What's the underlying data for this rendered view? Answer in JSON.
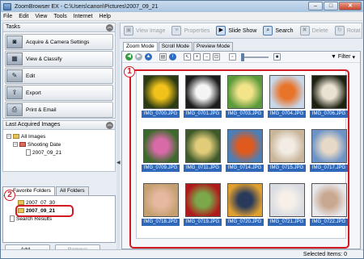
{
  "window": {
    "title": "ZoomBrowser EX - C:\\Users\\canon\\Pictures\\2007_09_21"
  },
  "menu": [
    "File",
    "Edit",
    "View",
    "Tools",
    "Internet",
    "Help"
  ],
  "tasks": {
    "header": "Tasks",
    "items": [
      {
        "label": "Acquire & Camera Settings",
        "icon": "camera-icon"
      },
      {
        "label": "View & Classify",
        "icon": "view-icon"
      },
      {
        "label": "Edit",
        "icon": "edit-icon"
      },
      {
        "label": "Export",
        "icon": "export-icon"
      },
      {
        "label": "Print & Email",
        "icon": "print-icon"
      }
    ]
  },
  "last_acquired": {
    "header": "Last Acquired Images",
    "all_images": "All Images",
    "shooting_date": "Shooting Date",
    "date": "2007_09_21"
  },
  "folders": {
    "tab_favorite": "Favorite Folders",
    "tab_all": "All Folders",
    "items": [
      "2007_07_30",
      "2007_09_21"
    ],
    "search": "Search Results",
    "add_label": "Add...",
    "remove_label": "Remove"
  },
  "toolbar": {
    "view_image": "View Image",
    "properties": "Properties",
    "slide_show": "Slide Show",
    "search": "Search",
    "delete": "Delete",
    "rotate": "Rotat"
  },
  "view_tabs": [
    "Zoom Mode",
    "Scroll Mode",
    "Preview Mode"
  ],
  "filter_label": "Filter",
  "callouts": [
    "1",
    "2"
  ],
  "thumbnails": [
    {
      "caption": "IMG_0700.JPG",
      "colors": [
        "#2b3a12",
        "#f0c21a"
      ]
    },
    {
      "caption": "IMG_0701.JPG",
      "colors": [
        "#1c1c1c",
        "#f4f4f4"
      ]
    },
    {
      "caption": "IMG_0703.JPG",
      "colors": [
        "#5a9a3a",
        "#f3e48a"
      ]
    },
    {
      "caption": "IMG_0704.JPG",
      "colors": [
        "#c8d7ea",
        "#e8742a"
      ]
    },
    {
      "caption": "IMG_0706.JPG",
      "colors": [
        "#1d2110",
        "#e9e1d2"
      ]
    },
    {
      "caption": "IMG_0709.JPG",
      "colors": [
        "#3b6a2a",
        "#d86aa8"
      ]
    },
    {
      "caption": "IMG_0711.JPG",
      "colors": [
        "#3f5a2a",
        "#e1cc7a"
      ]
    },
    {
      "caption": "IMG_0714.JPG",
      "colors": [
        "#4a7fb8",
        "#e05a1e"
      ]
    },
    {
      "caption": "IMG_0715.JPG",
      "colors": [
        "#c9b59a",
        "#f2ece4"
      ]
    },
    {
      "caption": "IMG_0717.JPG",
      "colors": [
        "#6c93c7",
        "#e7d9c7"
      ]
    },
    {
      "caption": "IMG_0718.JPG",
      "colors": [
        "#c4a070",
        "#e6b8a0"
      ]
    },
    {
      "caption": "IMG_0719.JPG",
      "colors": [
        "#b01a1a",
        "#7aa84a"
      ]
    },
    {
      "caption": "IMG_0720.JPG",
      "colors": [
        "#e0a030",
        "#2a3a5a"
      ]
    },
    {
      "caption": "IMG_0721.JPG",
      "colors": [
        "#d8dbe2",
        "#f6f0e8"
      ]
    },
    {
      "caption": "IMG_0722.JPG",
      "colors": [
        "#e8e8ec",
        "#c8a890"
      ]
    }
  ],
  "status": {
    "selected": "Selected Items: 0"
  },
  "colors": {
    "accent": "#2f68b8",
    "highlight": "#d21a22"
  }
}
